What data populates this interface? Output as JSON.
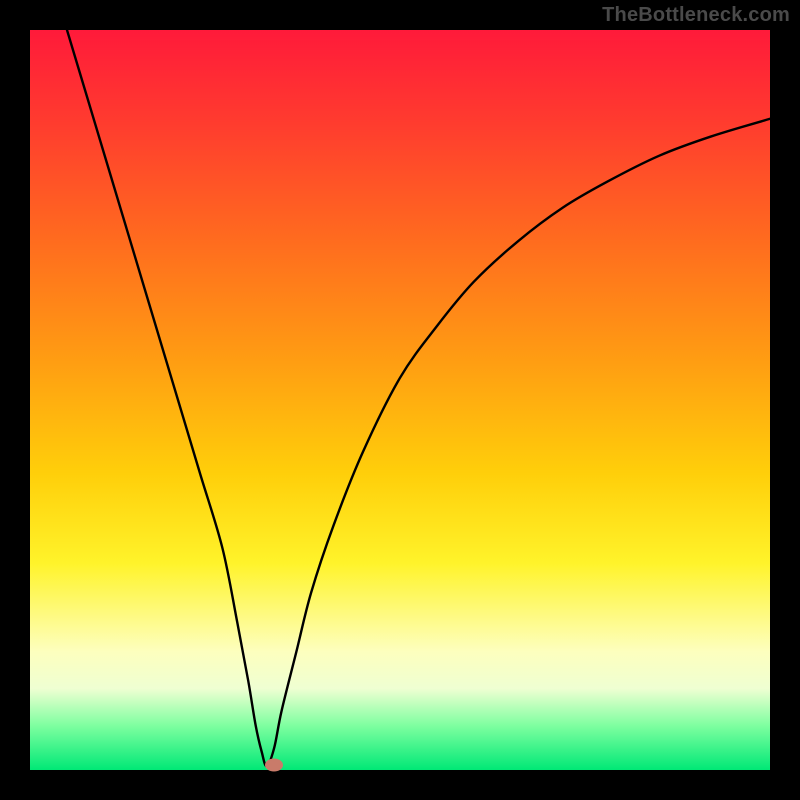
{
  "watermark": "TheBottleneck.com",
  "chart_data": {
    "type": "line",
    "title": "",
    "xlabel": "",
    "ylabel": "",
    "xlim": [
      0,
      100
    ],
    "ylim": [
      0,
      100
    ],
    "grid": false,
    "legend": false,
    "background_gradient": {
      "orientation": "top-to-bottom",
      "stops": [
        {
          "pos": 0.0,
          "color": "#ff1a3a"
        },
        {
          "pos": 0.12,
          "color": "#ff3a2f"
        },
        {
          "pos": 0.28,
          "color": "#ff6a1f"
        },
        {
          "pos": 0.45,
          "color": "#ff9e12"
        },
        {
          "pos": 0.6,
          "color": "#ffcf0a"
        },
        {
          "pos": 0.72,
          "color": "#fff32a"
        },
        {
          "pos": 0.84,
          "color": "#fdffbe"
        },
        {
          "pos": 0.89,
          "color": "#efffd2"
        },
        {
          "pos": 0.94,
          "color": "#7effa0"
        },
        {
          "pos": 1.0,
          "color": "#00e876"
        }
      ]
    },
    "series": [
      {
        "name": "bottleneck-curve",
        "stroke": "#000000",
        "x": [
          5,
          8,
          11,
          14,
          17,
          20,
          23,
          26,
          28,
          29.5,
          30.5,
          31.3,
          32,
          33,
          34,
          36,
          38,
          41,
          45,
          50,
          55,
          60,
          66,
          72,
          78,
          85,
          92,
          100
        ],
        "y": [
          100,
          90,
          80,
          70,
          60,
          50,
          40,
          30,
          20,
          12,
          6,
          2.5,
          0.5,
          3,
          8,
          16,
          24,
          33,
          43,
          53,
          60,
          66,
          71.5,
          76,
          79.5,
          83,
          85.6,
          88
        ]
      }
    ],
    "marker": {
      "name": "optimal-point",
      "x": 33,
      "y": 0.7,
      "color": "#c97b6a"
    }
  }
}
